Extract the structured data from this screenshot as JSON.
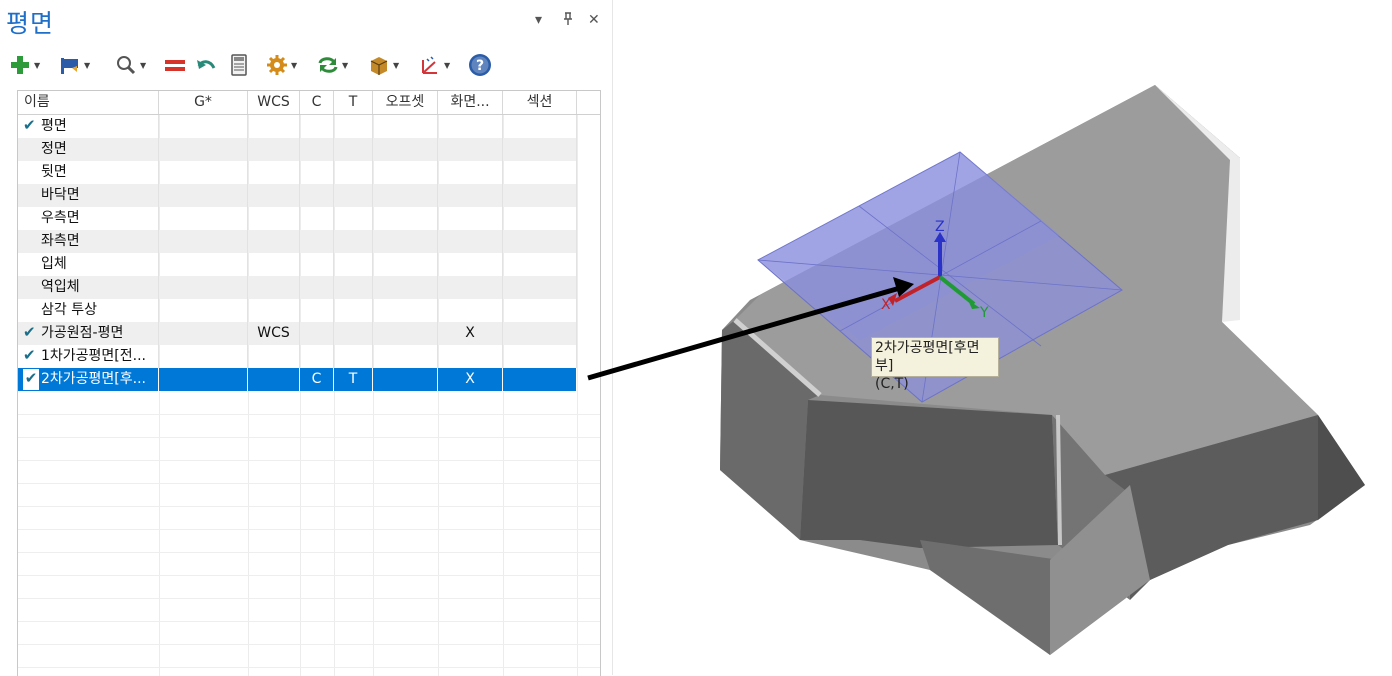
{
  "panel": {
    "title": "평면",
    "controls": {
      "dropdown": "▾",
      "pin": "⊥",
      "close": "✕"
    }
  },
  "toolbar": [
    {
      "icon": "plus-icon",
      "color": "#2e9b3b",
      "has_dropdown": true
    },
    {
      "icon": "flag-icon",
      "color": "#2b5ca8",
      "has_dropdown": true
    },
    {
      "icon": "magnifier-icon",
      "color": "#555555",
      "has_dropdown": true
    },
    {
      "icon": "equals-icon",
      "color": "#d6342a",
      "has_dropdown": false
    },
    {
      "icon": "undo-icon",
      "color": "#2a8a7a",
      "has_dropdown": false
    },
    {
      "icon": "calculator-icon",
      "color": "#555555",
      "has_dropdown": false
    },
    {
      "icon": "gear-icon",
      "color": "#d48b1a",
      "has_dropdown": true
    },
    {
      "icon": "refresh-icon",
      "color": "#2e8b3a",
      "has_dropdown": true
    },
    {
      "icon": "box-icon",
      "color": "#c48a2a",
      "has_dropdown": true
    },
    {
      "icon": "axes-icon",
      "color": "#d2363a",
      "has_dropdown": true
    },
    {
      "icon": "help-icon",
      "color": "#2b5ca8",
      "has_dropdown": false
    }
  ],
  "table": {
    "columns": [
      "이름",
      "G*",
      "WCS",
      "C",
      "T",
      "오프셋",
      "화면...",
      "섹션"
    ],
    "rows": [
      {
        "checked": true,
        "name": "평면",
        "g": "",
        "wcs": "",
        "c": "",
        "t": "",
        "offset": "",
        "display": "",
        "section": ""
      },
      {
        "checked": false,
        "name": "정면",
        "g": "",
        "wcs": "",
        "c": "",
        "t": "",
        "offset": "",
        "display": "",
        "section": ""
      },
      {
        "checked": false,
        "name": "뒷면",
        "g": "",
        "wcs": "",
        "c": "",
        "t": "",
        "offset": "",
        "display": "",
        "section": ""
      },
      {
        "checked": false,
        "name": "바닥면",
        "g": "",
        "wcs": "",
        "c": "",
        "t": "",
        "offset": "",
        "display": "",
        "section": ""
      },
      {
        "checked": false,
        "name": "우측면",
        "g": "",
        "wcs": "",
        "c": "",
        "t": "",
        "offset": "",
        "display": "",
        "section": ""
      },
      {
        "checked": false,
        "name": "좌측면",
        "g": "",
        "wcs": "",
        "c": "",
        "t": "",
        "offset": "",
        "display": "",
        "section": ""
      },
      {
        "checked": false,
        "name": "입체",
        "g": "",
        "wcs": "",
        "c": "",
        "t": "",
        "offset": "",
        "display": "",
        "section": ""
      },
      {
        "checked": false,
        "name": "역입체",
        "g": "",
        "wcs": "",
        "c": "",
        "t": "",
        "offset": "",
        "display": "",
        "section": ""
      },
      {
        "checked": false,
        "name": "삼각 투상",
        "g": "",
        "wcs": "",
        "c": "",
        "t": "",
        "offset": "",
        "display": "",
        "section": ""
      },
      {
        "checked": true,
        "name": "가공원점-평면",
        "g": "",
        "wcs": "WCS",
        "c": "",
        "t": "",
        "offset": "",
        "display": "X",
        "section": ""
      },
      {
        "checked": true,
        "name": "1차가공평면[전...",
        "g": "",
        "wcs": "",
        "c": "",
        "t": "",
        "offset": "",
        "display": "",
        "section": ""
      },
      {
        "checked": true,
        "name": "2차가공평면[후...",
        "g": "",
        "wcs": "",
        "c": "C",
        "t": "T",
        "offset": "",
        "display": "X",
        "section": "",
        "selected": true
      }
    ]
  },
  "viewport": {
    "axis_labels": {
      "x": "X",
      "y": "Y",
      "z": "Z"
    },
    "tooltip": {
      "line1": "2차가공평면[후면부]",
      "line2": "(C,T)"
    },
    "colors": {
      "plane": "#8a8fe0",
      "model": "#9a9a9a",
      "selection": "#0078d7"
    }
  }
}
